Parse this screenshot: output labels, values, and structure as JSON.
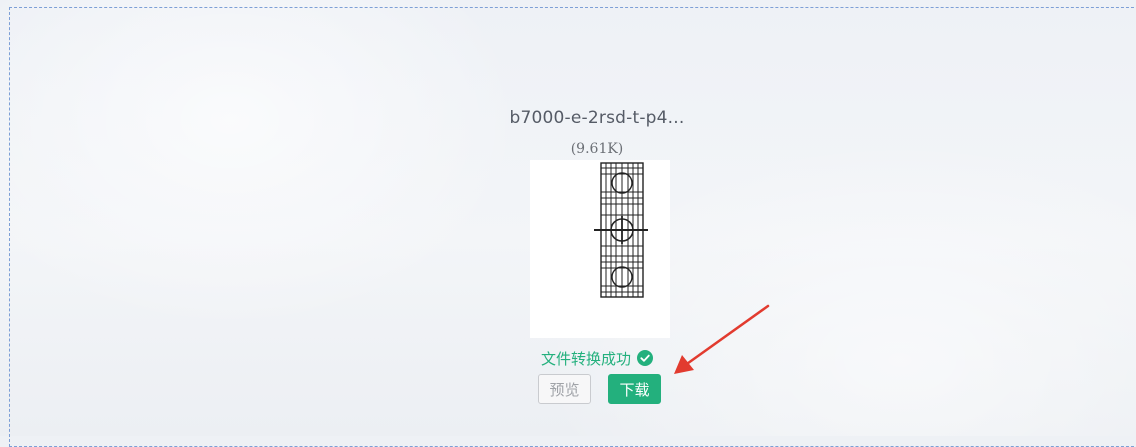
{
  "file": {
    "name": "b7000-e-2rsd-t-p4...",
    "size": "(9.61K)",
    "status": "文件转换成功"
  },
  "actions": {
    "preview_label": "预览",
    "download_label": "下载"
  },
  "colors": {
    "success": "#23b07d",
    "border_dashed": "#7d9fd6",
    "arrow": "#e23b2f"
  },
  "icons": {
    "status": "check-circle-icon",
    "annotation": "red-arrow-icon"
  }
}
